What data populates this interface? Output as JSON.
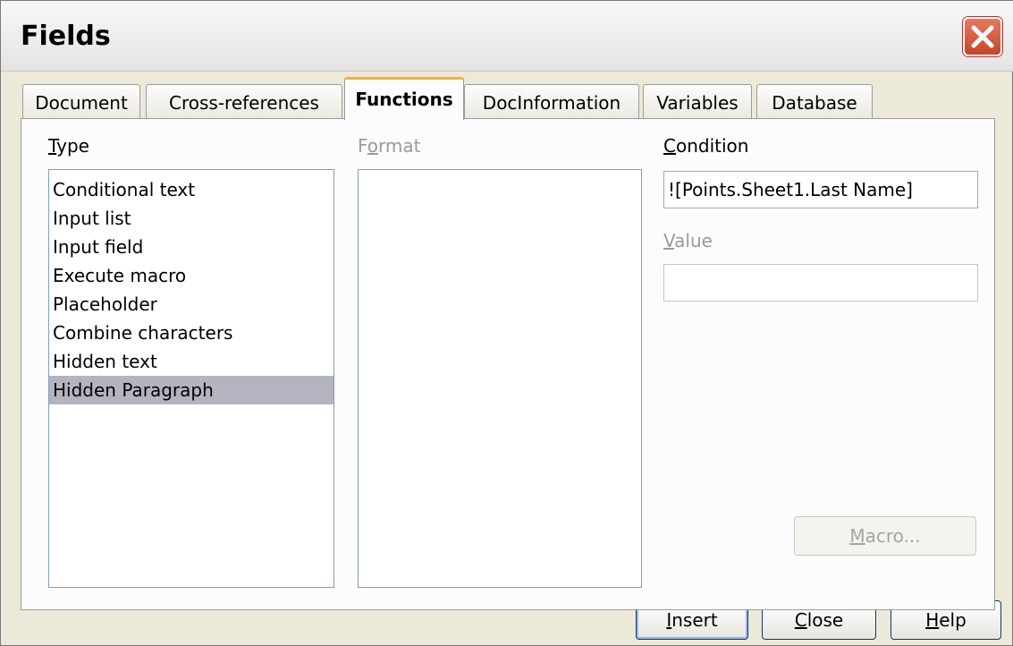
{
  "window": {
    "title": "Fields",
    "close_icon": "close-icon"
  },
  "tabs": [
    {
      "label": "Document"
    },
    {
      "label": "Cross-references"
    },
    {
      "label": "Functions",
      "active": true
    },
    {
      "label": "DocInformation"
    },
    {
      "label": "Variables"
    },
    {
      "label": "Database"
    }
  ],
  "type_section": {
    "label_first": "T",
    "label_rest": "ype",
    "items": [
      "Conditional text",
      "Input list",
      "Input field",
      "Execute macro",
      "Placeholder",
      "Combine characters",
      "Hidden text",
      "Hidden Paragraph"
    ],
    "selected": "Hidden Paragraph"
  },
  "format_section": {
    "label_first": "F",
    "label_mid": "o",
    "label_rest": "rmat"
  },
  "condition_section": {
    "label_first": "C",
    "label_rest": "ondition",
    "value": "![Points.Sheet1.Last Name]"
  },
  "value_section": {
    "label_first": "V",
    "label_rest": "alue",
    "value": ""
  },
  "buttons": {
    "macro_first": "M",
    "macro_rest": "acro...",
    "insert_first": "I",
    "insert_rest": "nsert",
    "close_first": "C",
    "close_rest": "lose",
    "help_first": "H",
    "help_rest": "elp"
  },
  "colors": {
    "active_tab_accent": "#f6b22c",
    "selection": "#b4b4c0",
    "close_button": "#d4563a"
  }
}
